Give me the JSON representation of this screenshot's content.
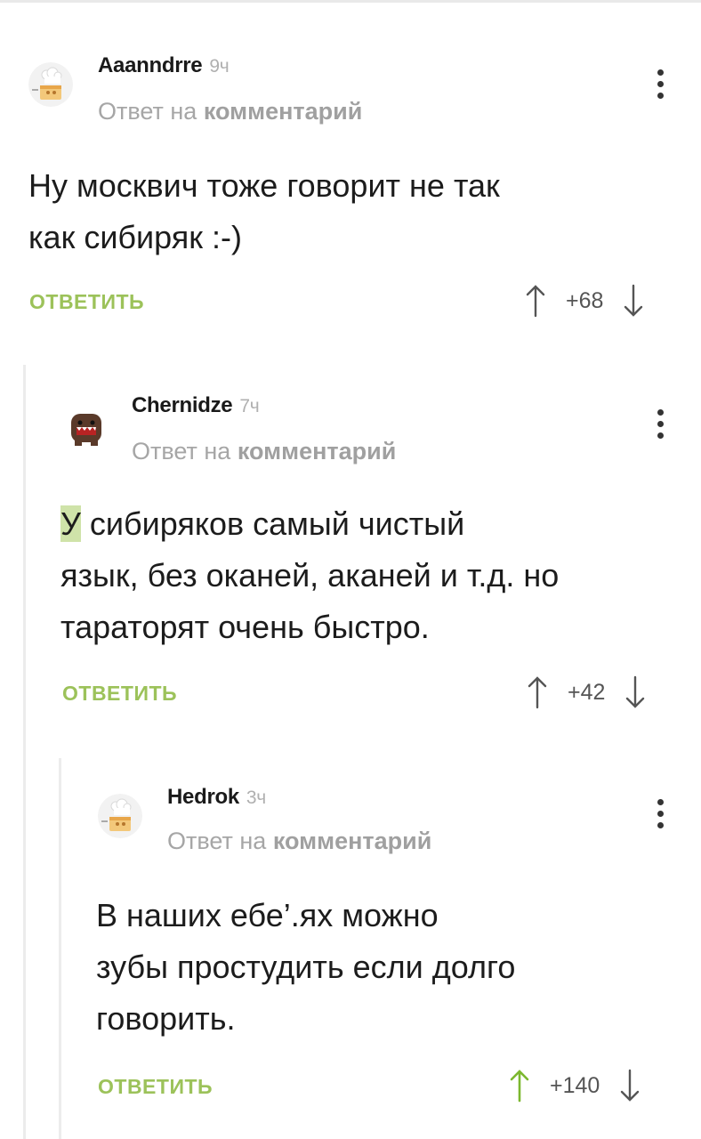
{
  "comments": [
    {
      "author": "Aaanndrre",
      "time": "9ч",
      "reply_prefix": "Ответ на",
      "reply_link": "комментарий",
      "text_line1": "Ну москвич тоже говорит не так",
      "text_line2": "как сибиряк :-)",
      "reply_label": "ОТВЕТИТЬ",
      "score": "+68",
      "avatar": "chef-hat-avatar"
    },
    {
      "author": "Chernidze",
      "time": "7ч",
      "reply_prefix": "Ответ на",
      "reply_link": "комментарий",
      "text_highlight": "У",
      "text_line1_rest": " сибиряков самый чистый",
      "text_line2": "язык, без оканей, аканей и т.д. но",
      "text_line3": "тараторят очень быстро.",
      "reply_label": "ОТВЕТИТЬ",
      "score": "+42",
      "avatar": "domo-avatar"
    },
    {
      "author": "Hedrok",
      "time": "3ч",
      "reply_prefix": "Ответ на",
      "reply_link": "комментарий",
      "text_line1": "В наших ебе’.ях можно",
      "text_line2": "зубы простудить если долго",
      "text_line3": "говорить.",
      "reply_label": "ОТВЕТИТЬ",
      "score": "+140",
      "avatar": "chef-hat-avatar",
      "upvoted": true
    }
  ],
  "icons": {
    "upvote": "arrow-up-icon",
    "downvote": "arrow-down-icon",
    "menu": "more-vertical-icon"
  },
  "colors": {
    "accent_green": "#9cc25a",
    "highlight": "#cfe3a9",
    "muted_text": "#a6a6a6",
    "thread_line": "#ececec"
  }
}
